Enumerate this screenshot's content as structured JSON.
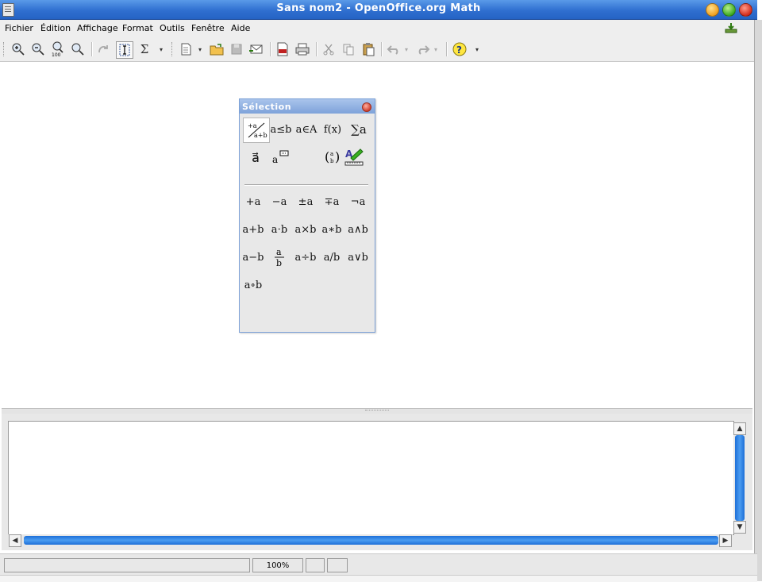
{
  "window": {
    "title": "Sans nom2 - OpenOffice.org Math"
  },
  "menubar": {
    "items": [
      {
        "label": "Fichier"
      },
      {
        "label": "Édition"
      },
      {
        "label": "Affichage"
      },
      {
        "label": "Format"
      },
      {
        "label": "Outils"
      },
      {
        "label": "Fenêtre"
      },
      {
        "label": "Aide"
      }
    ]
  },
  "toolbar": {
    "zoom_in_icon": "zoom-in-icon",
    "zoom_out_icon": "zoom-out-icon",
    "zoom_100_icon": "zoom-100-icon",
    "show_all_icon": "show-all-icon",
    "update_icon": "update-icon",
    "formula_cursor_icon": "formula-cursor-icon",
    "selection_toggle_glyph": "Σ",
    "zoom_100_label": "100"
  },
  "selection_window": {
    "title": "Sélection",
    "categories": [
      {
        "label": "+a/a+b",
        "name": "unary-binary"
      },
      {
        "label": "a≤b",
        "name": "relations"
      },
      {
        "label": "a∈A",
        "name": "set-operations"
      },
      {
        "label": "f(x)",
        "name": "functions"
      },
      {
        "label": "∑a",
        "name": "operators"
      },
      {
        "label": "a⃗",
        "name": "attributes"
      },
      {
        "label": "a",
        "name": "others"
      },
      {
        "label": "(a b)",
        "name": "brackets"
      },
      {
        "label": "A",
        "name": "formats"
      }
    ],
    "symbols": [
      [
        "+a",
        "−a",
        "±a",
        "∓a",
        "¬a"
      ],
      [
        "a+b",
        "a⋅b",
        "a×b",
        "a∗b",
        "a∧b"
      ],
      [
        "a−b",
        "a/b",
        "a÷b",
        "a/b",
        "a∨b"
      ],
      [
        "a∘b"
      ]
    ]
  },
  "statusbar": {
    "zoom": "100%"
  },
  "colors": {
    "titlebar": "#2f6fd0",
    "scroll_thumb": "#1d6fd8",
    "background": "#e8e8e8"
  }
}
